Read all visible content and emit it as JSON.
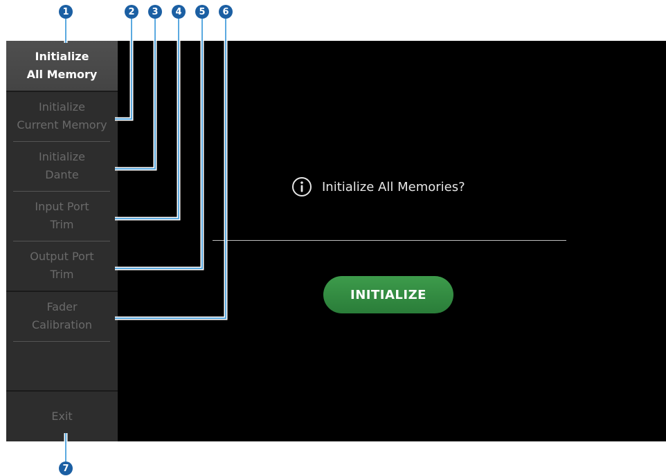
{
  "sidebar": {
    "items": [
      {
        "line1": "Initialize",
        "line2": "All Memory"
      },
      {
        "line1": "Initialize",
        "line2": "Current Memory"
      },
      {
        "line1": "Initialize",
        "line2": "Dante"
      },
      {
        "line1": "Input Port",
        "line2": "Trim"
      },
      {
        "line1": "Output Port",
        "line2": "Trim"
      },
      {
        "line1": "Fader",
        "line2": "Calibration"
      }
    ],
    "exit_label": "Exit"
  },
  "main": {
    "message": "Initialize All Memories?",
    "initialize_label": "INITIALIZE"
  },
  "callouts": [
    "1",
    "2",
    "3",
    "4",
    "5",
    "6",
    "7"
  ],
  "colors": {
    "accent_button": "#2f8a3e",
    "callout": "#1b5fa3",
    "leader_line": "#5aa9e0"
  }
}
